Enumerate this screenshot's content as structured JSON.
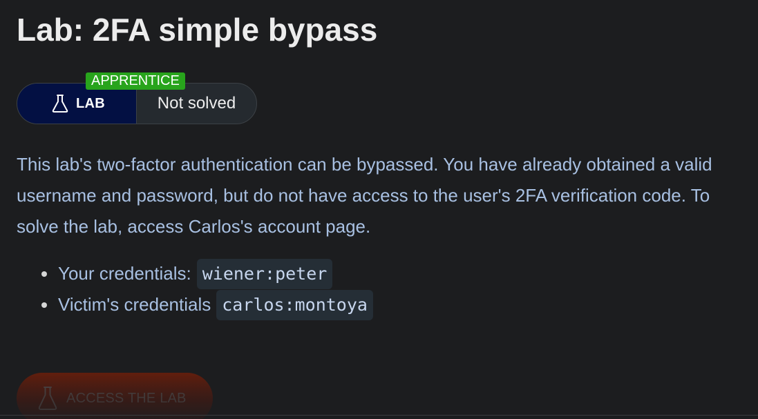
{
  "page": {
    "title": "Lab: 2FA simple bypass"
  },
  "lab_widget": {
    "level_badge": "APPRENTICE",
    "lab_label": "LAB",
    "status": "Not solved",
    "icon": "flask-icon",
    "colors": {
      "pill_bg": "#031043",
      "badge_bg": "#28a41c"
    }
  },
  "description": "This lab's two-factor authentication can be bypassed. You have already obtained a valid username and password, but do not have access to the user's 2FA verification code. To solve the lab, access Carlos's account page.",
  "credentials": [
    {
      "label": "Your credentials:",
      "value": "wiener:peter"
    },
    {
      "label": "Victim's credentials",
      "value": "carlos:montoya"
    }
  ],
  "access_button": {
    "label": "ACCESS THE LAB",
    "icon": "flask-icon",
    "color": "#6e1f0b"
  }
}
